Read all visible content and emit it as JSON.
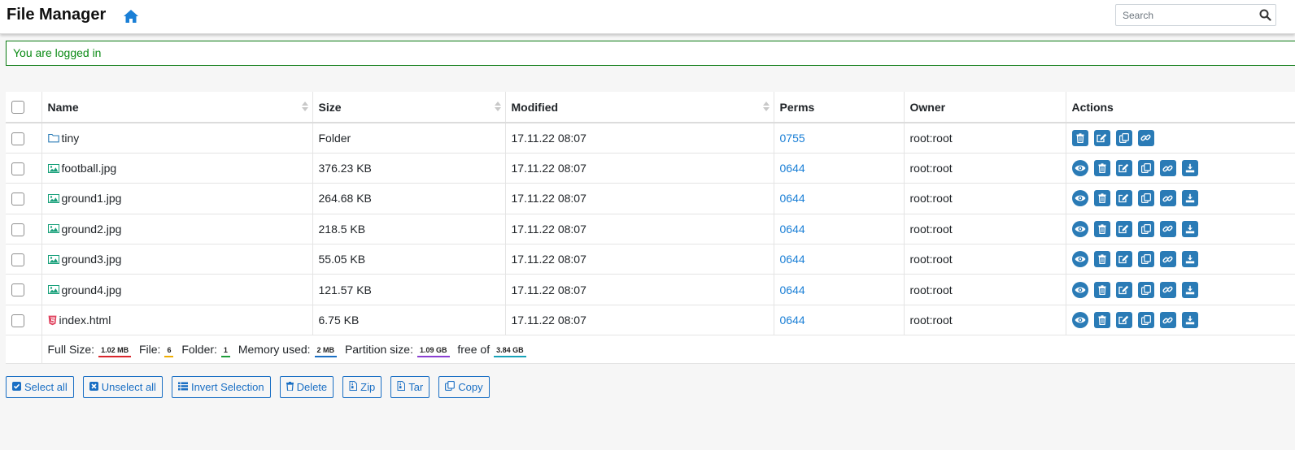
{
  "header": {
    "title": "File Manager",
    "home_icon": "home-icon",
    "search_placeholder": "Search",
    "search_icon": "search-icon"
  },
  "alert": {
    "message": "You are logged in"
  },
  "table": {
    "columns": [
      "Name",
      "Size",
      "Modified",
      "Perms",
      "Owner",
      "Actions"
    ],
    "rows": [
      {
        "type": "folder",
        "name": "tiny",
        "size": "Folder",
        "modified": "17.11.22 08:07",
        "perms": "0755",
        "owner": "root:root"
      },
      {
        "type": "image",
        "name": "football.jpg",
        "size": "376.23 KB",
        "modified": "17.11.22 08:07",
        "perms": "0644",
        "owner": "root:root"
      },
      {
        "type": "image",
        "name": "ground1.jpg",
        "size": "264.68 KB",
        "modified": "17.11.22 08:07",
        "perms": "0644",
        "owner": "root:root"
      },
      {
        "type": "image",
        "name": "ground2.jpg",
        "size": "218.5 KB",
        "modified": "17.11.22 08:07",
        "perms": "0644",
        "owner": "root:root"
      },
      {
        "type": "image",
        "name": "ground3.jpg",
        "size": "55.05 KB",
        "modified": "17.11.22 08:07",
        "perms": "0644",
        "owner": "root:root"
      },
      {
        "type": "image",
        "name": "ground4.jpg",
        "size": "121.57 KB",
        "modified": "17.11.22 08:07",
        "perms": "0644",
        "owner": "root:root"
      },
      {
        "type": "html",
        "name": "index.html",
        "size": "6.75 KB",
        "modified": "17.11.22 08:07",
        "perms": "0644",
        "owner": "root:root"
      }
    ]
  },
  "footer": {
    "full_size_label": "Full Size:",
    "full_size": "1.02 MB",
    "file_label": "File:",
    "file_count": "6",
    "folder_label": "Folder:",
    "folder_count": "1",
    "memory_label": "Memory used:",
    "memory": "2 MB",
    "partition_label": "Partition size:",
    "partition": "1.09 GB",
    "free_label": "free of",
    "free": "3.84 GB"
  },
  "buttons": {
    "select_all": "Select all",
    "unselect_all": "Unselect all",
    "invert_selection": "Invert Selection",
    "delete": "Delete",
    "zip": "Zip",
    "tar": "Tar",
    "copy": "Copy"
  },
  "colors": {
    "action_blue": "#2a7bb6",
    "link_blue": "#1a7fd6",
    "alert_green": "#0a8a14",
    "badge_red": "#d9262c",
    "badge_yellow": "#f0ad00",
    "badge_green": "#1e9e3a",
    "badge_blue": "#1a6fc4",
    "badge_purple": "#8a3fd1",
    "badge_teal": "#17a2b8"
  }
}
